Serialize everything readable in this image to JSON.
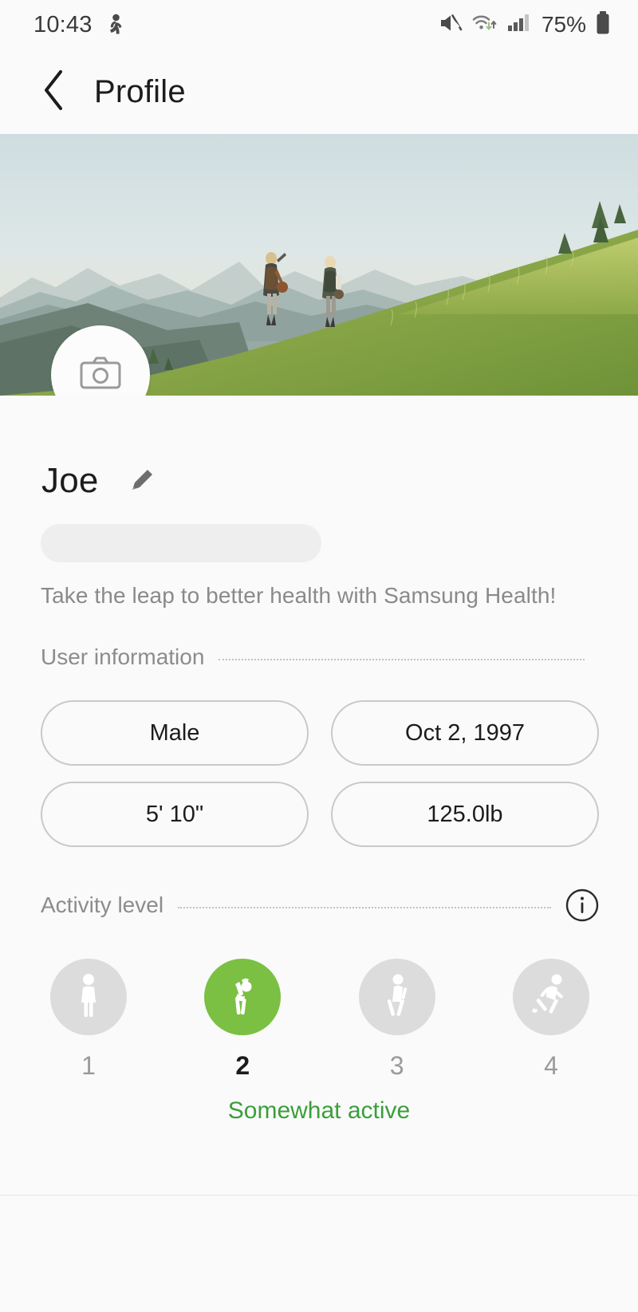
{
  "status_bar": {
    "time": "10:43",
    "battery_percent": "75%",
    "icons": [
      "fitness-app-icon",
      "mute-icon",
      "wifi-icon",
      "signal-icon",
      "battery-icon"
    ]
  },
  "header": {
    "back_icon": "chevron-left-icon",
    "title": "Profile"
  },
  "cover": {
    "camera_icon": "camera-icon",
    "alt": "two hikers walking up a grassy mountain ridge"
  },
  "profile": {
    "name": "Joe",
    "edit_icon": "pencil-icon",
    "tagline": "Take the leap to better health with Samsung Health!"
  },
  "user_information": {
    "section_label": "User information",
    "fields": [
      {
        "name": "gender",
        "value": "Male"
      },
      {
        "name": "birthdate",
        "value": "Oct 2, 1997"
      },
      {
        "name": "height",
        "value": "5' 10\""
      },
      {
        "name": "weight",
        "value": "125.0lb"
      }
    ]
  },
  "activity_level": {
    "section_label": "Activity level",
    "info_icon": "info-icon",
    "levels": [
      {
        "num": "1",
        "icon": "standing-person-icon",
        "selected": false
      },
      {
        "num": "2",
        "icon": "stretching-person-icon",
        "selected": true
      },
      {
        "num": "3",
        "icon": "walking-person-icon",
        "selected": false
      },
      {
        "num": "4",
        "icon": "running-person-icon",
        "selected": false
      }
    ],
    "selected_label": "Somewhat active"
  },
  "colors": {
    "accent_green": "#7bc043",
    "accent_text_green": "#3a9f3a",
    "background": "#fafafa",
    "chip_border": "#c9c9c9",
    "muted_text": "#8c8c8c"
  }
}
